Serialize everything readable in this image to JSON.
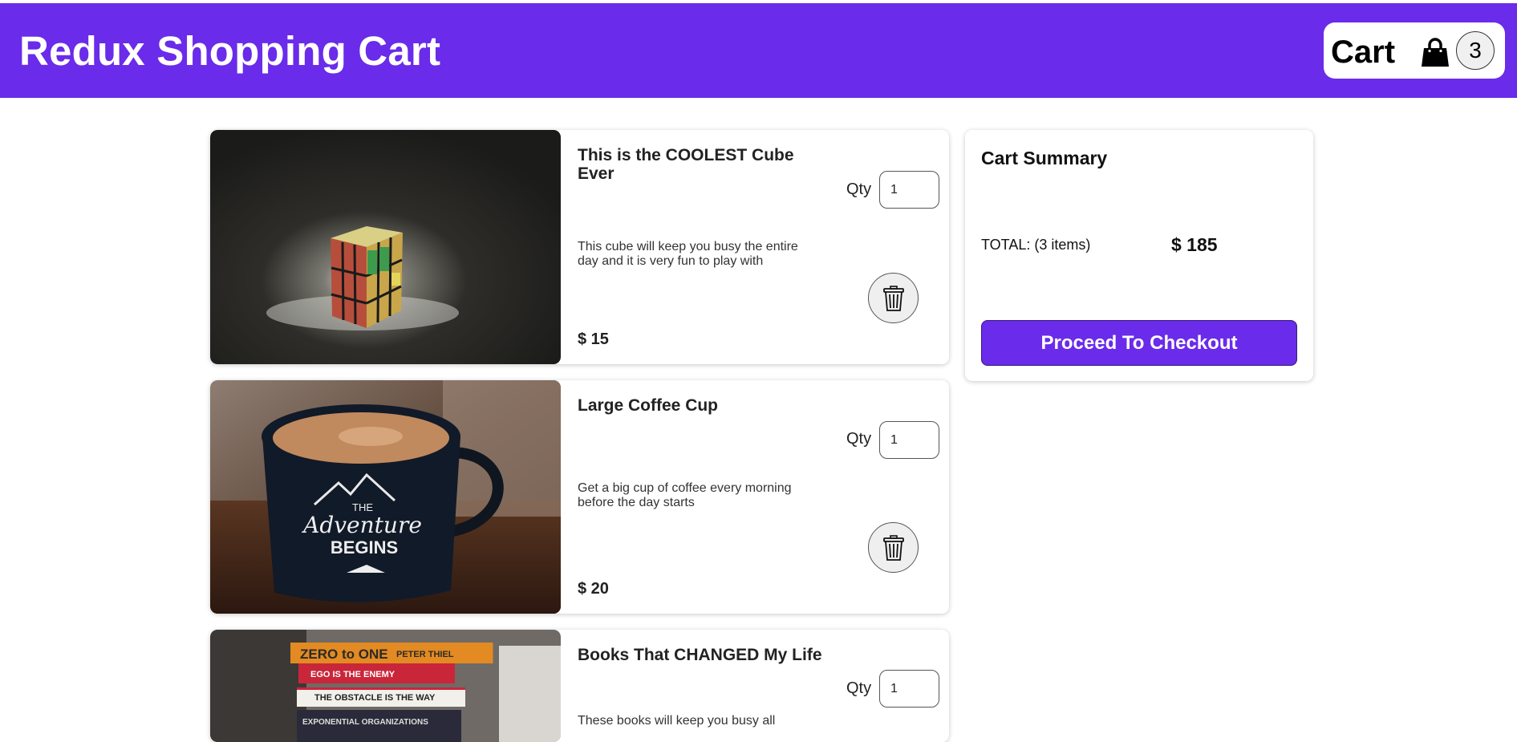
{
  "app": {
    "title": "Redux Shopping Cart"
  },
  "header_cart": {
    "label": "Cart",
    "count": "3",
    "icon": "shopping-bag-icon"
  },
  "items": [
    {
      "title": "This is the COOLEST Cube Ever",
      "description": "This cube will keep you busy the entire day and it is very fun to play with",
      "price": "$ 15",
      "qty_label": "Qty",
      "qty": "1",
      "image": "rubiks-cube-photo"
    },
    {
      "title": "Large Coffee Cup",
      "description": "Get a big cup of coffee every morning before the day starts",
      "price": "$ 20",
      "qty_label": "Qty",
      "qty": "1",
      "image": "coffee-mug-photo",
      "image_text": {
        "line1": "THE",
        "line2": "Adventure",
        "line3": "BEGINS"
      }
    },
    {
      "title": "Books That CHANGED My Life",
      "description": "These books will keep you busy all",
      "qty_label": "Qty",
      "qty": "1",
      "image": "book-stack-photo",
      "image_text": {
        "book1": "ZERO to ONE",
        "book1_author": "PETER THIEL",
        "book2": "EGO IS THE ENEMY",
        "book3": "THE OBSTACLE IS THE WAY",
        "book4": "EXPONENTIAL ORGANIZATIONS"
      }
    }
  ],
  "summary": {
    "title": "Cart Summary",
    "total_label": "TOTAL: (3 items)",
    "total_value": "$ 185",
    "checkout_label": "Proceed To Checkout"
  },
  "colors": {
    "accent": "#6a2bea",
    "background": "#ffffff",
    "text": "#222222"
  }
}
